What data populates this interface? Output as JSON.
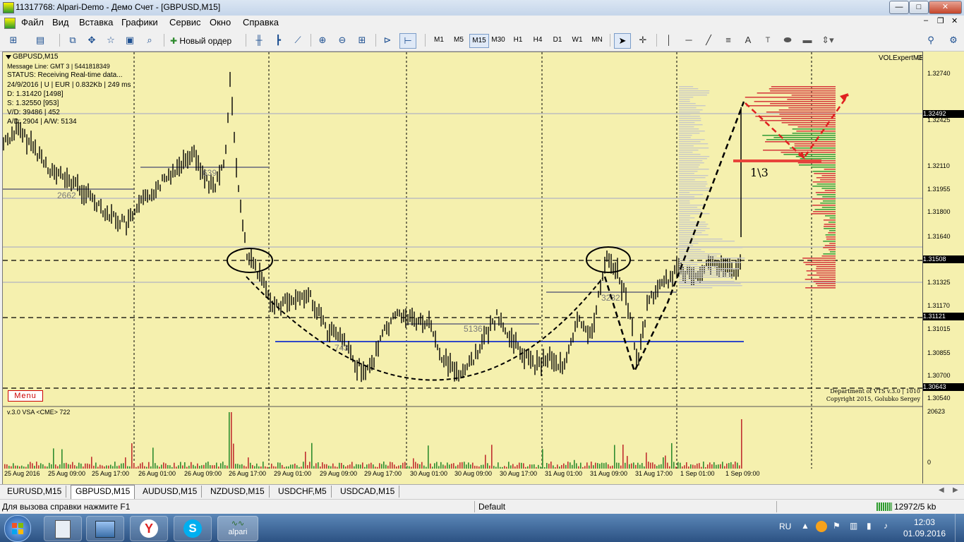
{
  "window": {
    "title": "11317768: Alpari-Demo - Демо Счет - [GBPUSD,M15]",
    "buttons": [
      "—",
      "□",
      "✕"
    ]
  },
  "menu": [
    "Файл",
    "Вид",
    "Вставка",
    "Графики",
    "Сервис",
    "Окно",
    "Справка"
  ],
  "toolbar": {
    "new_order": "Новый ордер",
    "timeframes": [
      "M1",
      "M5",
      "M15",
      "M30",
      "H1",
      "H4",
      "D1",
      "W1",
      "MN"
    ],
    "selected_timeframe": "M15",
    "text_tool": "A"
  },
  "chart": {
    "symbol": "GBPUSD,M15",
    "info_lines": [
      "Message Line: GMT 3 | 5441818349",
      "STATUS:  Receiving Real-time data...",
      "24/9/2016 | U | EUR | 0.832Kb | 249 ms",
      "D: 1.31420  [1498]",
      "S: 1.32550  [953]",
      "V/D: 39486 | 452",
      "A/D: 2904 | A/W: 5134"
    ],
    "expert": "VOLExpertME",
    "menu_button": "Menu",
    "copyright_1": "Department of VTS  v.3.0 | 1010",
    "copyright_2": "Copyright 2015, Golubko Sergey",
    "annotation": "1\\3",
    "level_labels": [
      "2662",
      "639",
      "743",
      "5136",
      "3232"
    ],
    "price_ticks": [
      "1.32740",
      "1.32425",
      "1.32110",
      "1.31955",
      "1.31800",
      "1.31640",
      "1.31325",
      "1.31170",
      "1.31015",
      "1.30855",
      "1.30700",
      "1.30540"
    ],
    "price_boxes": [
      "1.32492",
      "1.31508",
      "1.31121",
      "1.30643"
    ],
    "time_labels": [
      "25 Aug 2016",
      "25 Aug 09:00",
      "25 Aug 17:00",
      "26 Aug 01:00",
      "26 Aug 09:00",
      "26 Aug 17:00",
      "29 Aug 01:00",
      "29 Aug 09:00",
      "29 Aug 17:00",
      "30 Aug 01:00",
      "30 Aug 09:00",
      "30 Aug 17:00",
      "31 Aug 01:00",
      "31 Aug 09:00",
      "31 Aug 17:00",
      "1 Sep 01:00",
      "1 Sep 09:00"
    ],
    "subwindow_title": "v.3.0 VSA <CME> 722",
    "sub_ticks": [
      "20623",
      "0"
    ]
  },
  "tabs": [
    "EURUSD,M15",
    "GBPUSD,M15",
    "AUDUSD,M15",
    "NZDUSD,M15",
    "USDCHF,M5",
    "USDCAD,M15"
  ],
  "active_tab": "GBPUSD,M15",
  "status": {
    "help": "Для вызова справки нажмите F1",
    "profile": "Default",
    "traffic": "12972/5 kb"
  },
  "taskbar": {
    "apps": [
      "windows-start",
      "calculator",
      "explorer",
      "yandex-browser",
      "skype",
      "alpari"
    ],
    "alpari_label": "alpari",
    "lang": "RU",
    "time": "12:03",
    "date": "01.09.2016"
  }
}
